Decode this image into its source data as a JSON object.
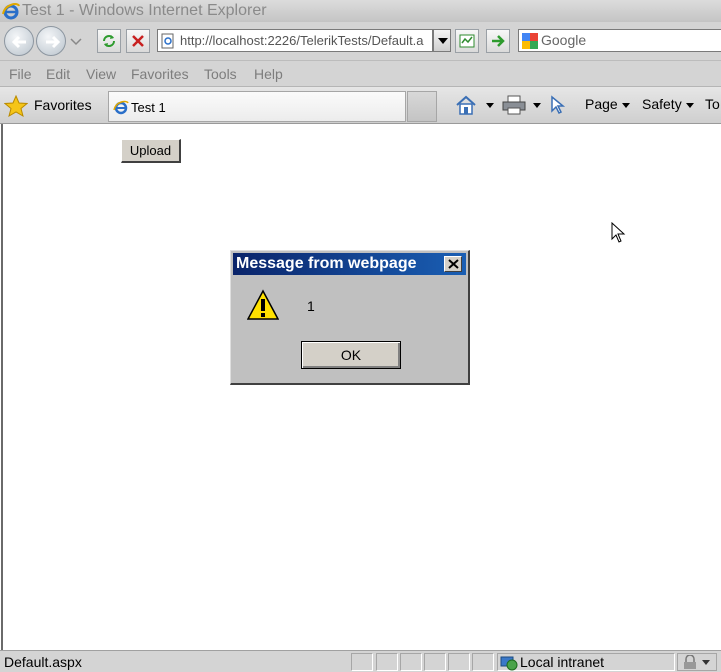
{
  "window": {
    "title": "Test 1 - Windows Internet Explorer"
  },
  "address_bar": {
    "url": "http://localhost:2226/TelerikTests/Default.a"
  },
  "search": {
    "placeholder": "Google"
  },
  "menu": [
    "File",
    "Edit",
    "View",
    "Favorites",
    "Tools",
    "Help"
  ],
  "favorites_bar": {
    "favorites_label": "Favorites",
    "tab_title": "Test 1"
  },
  "command_bar": {
    "page": "Page",
    "safety": "Safety",
    "tools_truncated": "To"
  },
  "page": {
    "upload_button": "Upload"
  },
  "dialog": {
    "title": "Message from webpage",
    "message": "1",
    "ok_label": "OK"
  },
  "status_bar": {
    "text": "Default.aspx",
    "zone": "Local intranet"
  }
}
